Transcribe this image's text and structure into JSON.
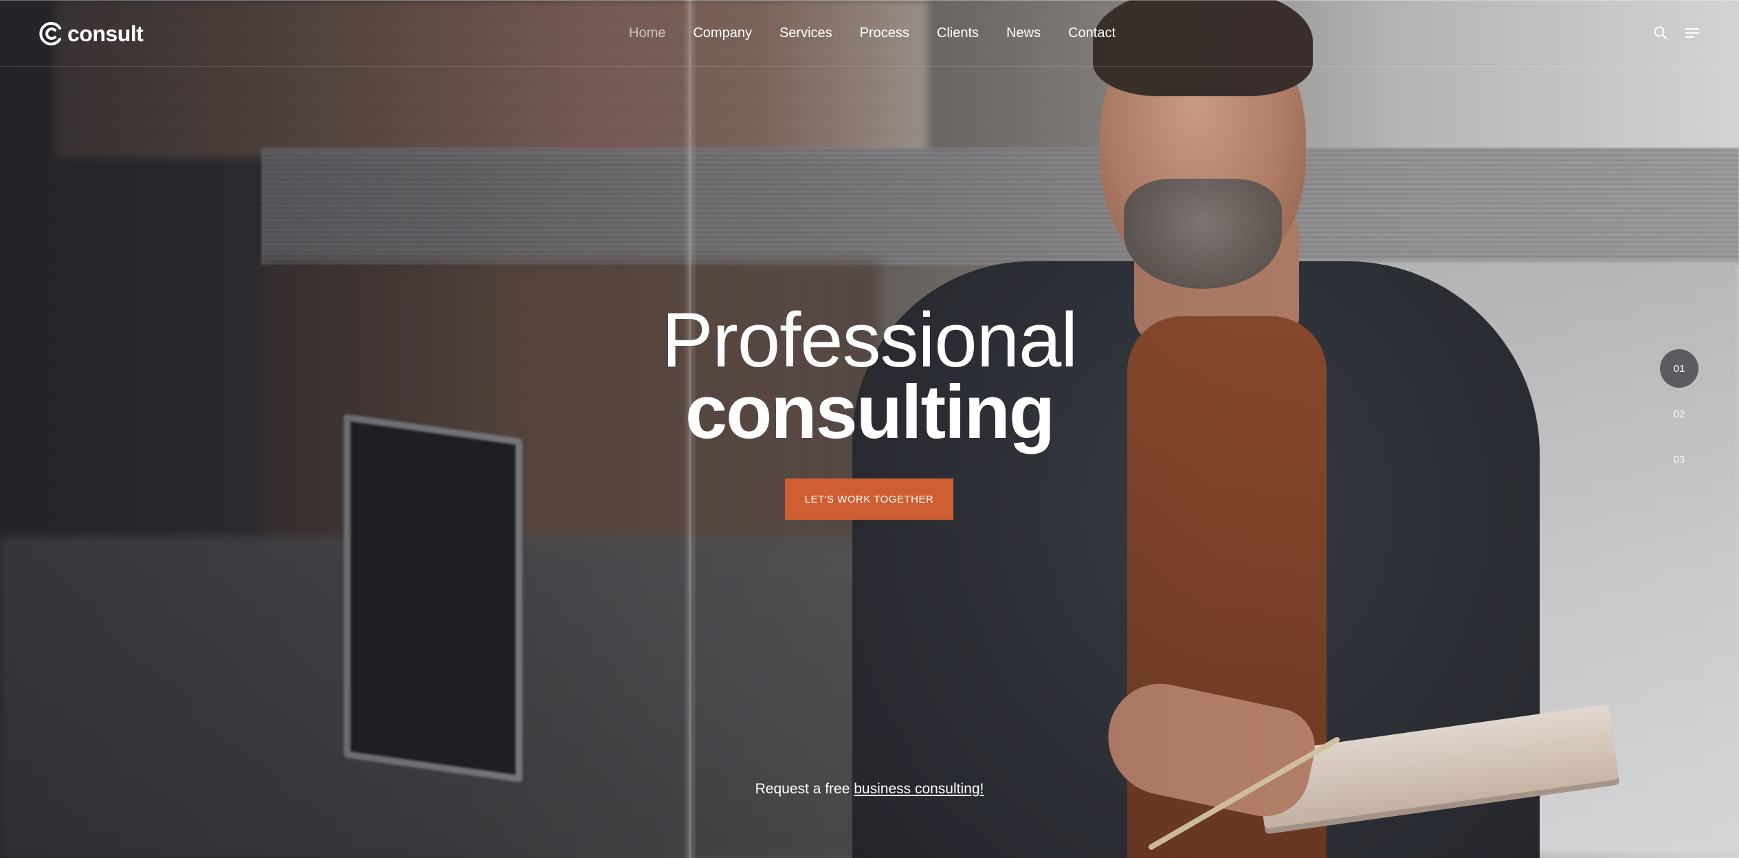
{
  "brand": {
    "name": "consult",
    "accent": "#cf5f33"
  },
  "nav": {
    "items": [
      {
        "label": "Home",
        "active": true
      },
      {
        "label": "Company",
        "active": false
      },
      {
        "label": "Services",
        "active": false
      },
      {
        "label": "Process",
        "active": false
      },
      {
        "label": "Clients",
        "active": false
      },
      {
        "label": "News",
        "active": false
      },
      {
        "label": "Contact",
        "active": false
      }
    ],
    "icons": [
      "search-icon",
      "menu-icon"
    ]
  },
  "hero": {
    "title_line1": "Professional",
    "title_line2": "consulting",
    "cta_label": "LET'S WORK TOGETHER",
    "sub_text": "Request a free ",
    "sub_link": "business consulting!"
  },
  "pager": {
    "items": [
      "01",
      "02",
      "03"
    ],
    "active_index": 0
  }
}
